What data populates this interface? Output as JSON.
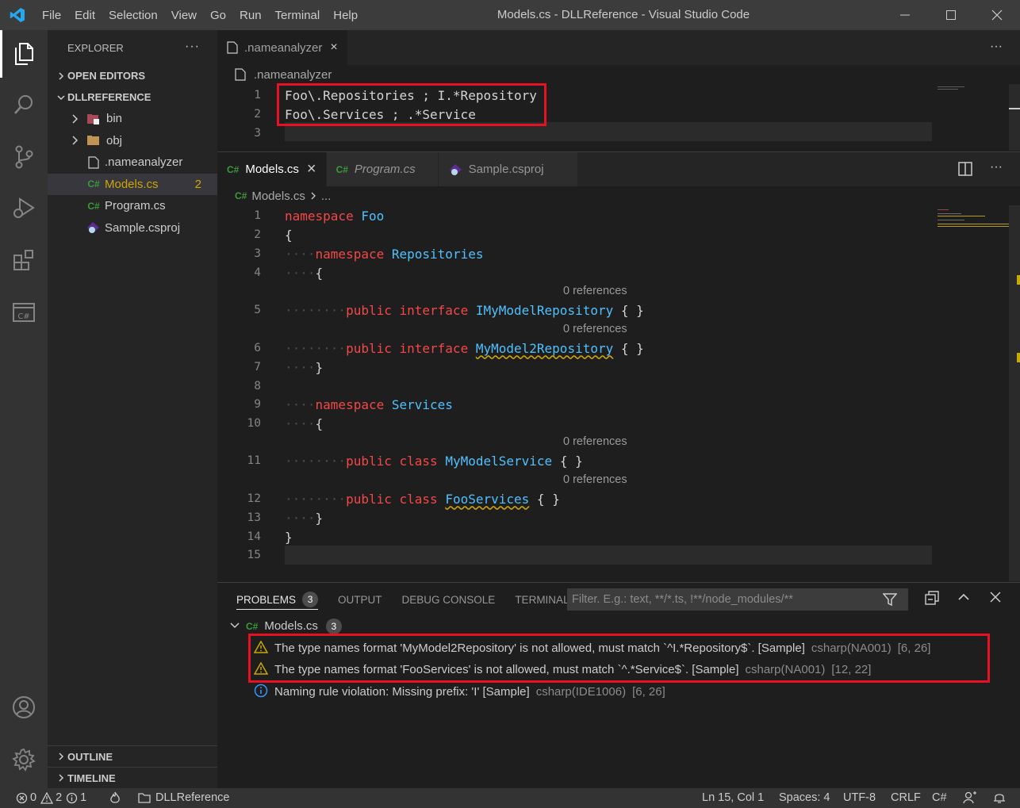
{
  "window": {
    "title": "Models.cs - DLLReference - Visual Studio Code",
    "menu": [
      "File",
      "Edit",
      "Selection",
      "View",
      "Go",
      "Run",
      "Terminal",
      "Help"
    ]
  },
  "sidebar": {
    "header": "EXPLORER",
    "more": "···",
    "open_editors": "OPEN EDITORS",
    "project": "DLLREFERENCE",
    "items": [
      {
        "label": "bin",
        "type": "folder"
      },
      {
        "label": "obj",
        "type": "folder"
      },
      {
        "label": ".nameanalyzer",
        "type": "file"
      },
      {
        "label": "Models.cs",
        "type": "csharp",
        "badge": "2",
        "selected": true
      },
      {
        "label": "Program.cs",
        "type": "csharp"
      },
      {
        "label": "Sample.csproj",
        "type": "csproj"
      }
    ],
    "outline": "OUTLINE",
    "timeline": "TIMELINE"
  },
  "top_editor": {
    "tab": ".nameanalyzer",
    "breadcrumb": ".nameanalyzer",
    "lines": [
      {
        "n": "1",
        "text": "Foo\\.Repositories ; I.*Repository"
      },
      {
        "n": "2",
        "text": "Foo\\.Services ; .*Service"
      },
      {
        "n": "3",
        "text": ""
      }
    ]
  },
  "main_editor": {
    "tabs": [
      {
        "label": "Models.cs",
        "active": true,
        "close": "×"
      },
      {
        "label": "Program.cs",
        "active": false
      },
      {
        "label": "Sample.csproj",
        "active": false
      }
    ],
    "breadcrumb_file": "Models.cs",
    "breadcrumb_rest": "...",
    "codelens": "0 references",
    "line_numbers": [
      "1",
      "2",
      "3",
      "4",
      "5",
      "6",
      "7",
      "8",
      "9",
      "10",
      "11",
      "12",
      "13",
      "14",
      "15"
    ],
    "code": {
      "kw_namespace": "namespace",
      "ns_foo": "Foo",
      "ns_repos": "Repositories",
      "ns_services": "Services",
      "kw_public": "public",
      "kw_interface": "interface",
      "kw_class": "class",
      "t_imymodel": "IMyModelRepository",
      "t_mymodel2": "MyModel2Repository",
      "t_mymodelservice": "MyModelService",
      "t_fooservices": "FooServices",
      "brace_open": "{",
      "brace_close": "}",
      "empty_body": "{ }"
    }
  },
  "panel": {
    "tabs": [
      {
        "label": "PROBLEMS",
        "badge": "3",
        "active": true
      },
      {
        "label": "OUTPUT"
      },
      {
        "label": "DEBUG CONSOLE"
      },
      {
        "label": "TERMINAL"
      }
    ],
    "filter_placeholder": "Filter. E.g.: text, **/*.ts, !**/node_modules/**",
    "file": "Models.cs",
    "file_count": "3",
    "problems": [
      {
        "severity": "warning",
        "message": "The type names format 'MyModel2Repository' is not allowed, must match `^I.*Repository$`. [Sample]",
        "source": "csharp(NA001)",
        "pos": "[6, 26]"
      },
      {
        "severity": "warning",
        "message": "The type names format 'FooServices' is not allowed, must match `^.*Service$`. [Sample]",
        "source": "csharp(NA001)",
        "pos": "[12, 22]"
      },
      {
        "severity": "info",
        "message": "Naming rule violation: Missing prefix: 'I' [Sample]",
        "source": "csharp(IDE1006)",
        "pos": "[6, 26]"
      }
    ]
  },
  "statusbar": {
    "errors": "0",
    "warnings": "2",
    "infos": "1",
    "folder": "DLLReference",
    "position": "Ln 15, Col 1",
    "spaces": "Spaces: 4",
    "encoding": "UTF-8",
    "eol": "CRLF",
    "language": "C#"
  },
  "colors": {
    "highlight_box": "#e81123",
    "keyword": "#f44747",
    "type": "#4fc1ff",
    "warning": "#cca700",
    "info": "#3794ff"
  }
}
